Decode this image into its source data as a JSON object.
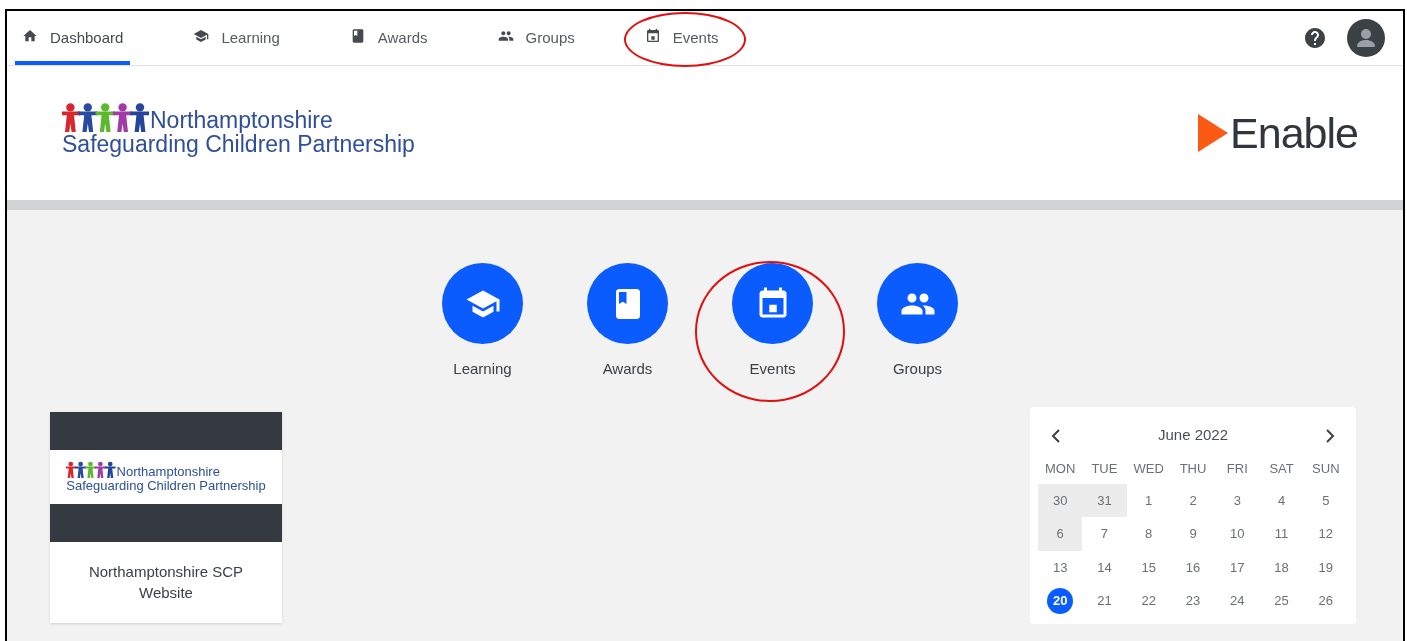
{
  "nav": {
    "items": [
      {
        "label": "Dashboard",
        "selected": true,
        "highlighted": false
      },
      {
        "label": "Learning",
        "selected": false,
        "highlighted": false
      },
      {
        "label": "Awards",
        "selected": false,
        "highlighted": false
      },
      {
        "label": "Groups",
        "selected": false,
        "highlighted": false
      },
      {
        "label": "Events",
        "selected": false,
        "highlighted": true
      }
    ]
  },
  "header": {
    "org_logo": {
      "line_1": "Northamptonshire",
      "line_2": "Safeguarding Children Partnership"
    },
    "brand_logo": "Enable"
  },
  "shortcuts": [
    {
      "label": "Learning",
      "highlighted": false
    },
    {
      "label": "Awards",
      "highlighted": false
    },
    {
      "label": "Events",
      "highlighted": true
    },
    {
      "label": "Groups",
      "highlighted": false
    }
  ],
  "cards": [
    {
      "logo_line_1": "Northamptonshire",
      "logo_line_2": "Safeguarding Children Partnership",
      "title": "Northamptonshire SCP Website"
    }
  ],
  "calendar": {
    "month": "June 2022",
    "weekdays": [
      "MON",
      "TUE",
      "WED",
      "THU",
      "FRI",
      "SAT",
      "SUN"
    ],
    "weeks": [
      [
        {
          "day": "30",
          "shaded": true,
          "selected": false
        },
        {
          "day": "31",
          "shaded": true,
          "selected": false
        },
        {
          "day": "1",
          "shaded": false,
          "selected": false
        },
        {
          "day": "2",
          "shaded": false,
          "selected": false
        },
        {
          "day": "3",
          "shaded": false,
          "selected": false
        },
        {
          "day": "4",
          "shaded": false,
          "selected": false
        },
        {
          "day": "5",
          "shaded": false,
          "selected": false
        }
      ],
      [
        {
          "day": "6",
          "shaded": true,
          "selected": false
        },
        {
          "day": "7",
          "shaded": false,
          "selected": false
        },
        {
          "day": "8",
          "shaded": false,
          "selected": false
        },
        {
          "day": "9",
          "shaded": false,
          "selected": false
        },
        {
          "day": "10",
          "shaded": false,
          "selected": false
        },
        {
          "day": "11",
          "shaded": false,
          "selected": false
        },
        {
          "day": "12",
          "shaded": false,
          "selected": false
        }
      ],
      [
        {
          "day": "13",
          "shaded": false,
          "selected": false
        },
        {
          "day": "14",
          "shaded": false,
          "selected": false
        },
        {
          "day": "15",
          "shaded": false,
          "selected": false
        },
        {
          "day": "16",
          "shaded": false,
          "selected": false
        },
        {
          "day": "17",
          "shaded": false,
          "selected": false
        },
        {
          "day": "18",
          "shaded": false,
          "selected": false
        },
        {
          "day": "19",
          "shaded": false,
          "selected": false
        }
      ],
      [
        {
          "day": "20",
          "shaded": false,
          "selected": true
        },
        {
          "day": "21",
          "shaded": false,
          "selected": false
        },
        {
          "day": "22",
          "shaded": false,
          "selected": false
        },
        {
          "day": "23",
          "shaded": false,
          "selected": false
        },
        {
          "day": "24",
          "shaded": false,
          "selected": false
        },
        {
          "day": "25",
          "shaded": false,
          "selected": false
        },
        {
          "day": "26",
          "shaded": false,
          "selected": false
        }
      ]
    ]
  }
}
